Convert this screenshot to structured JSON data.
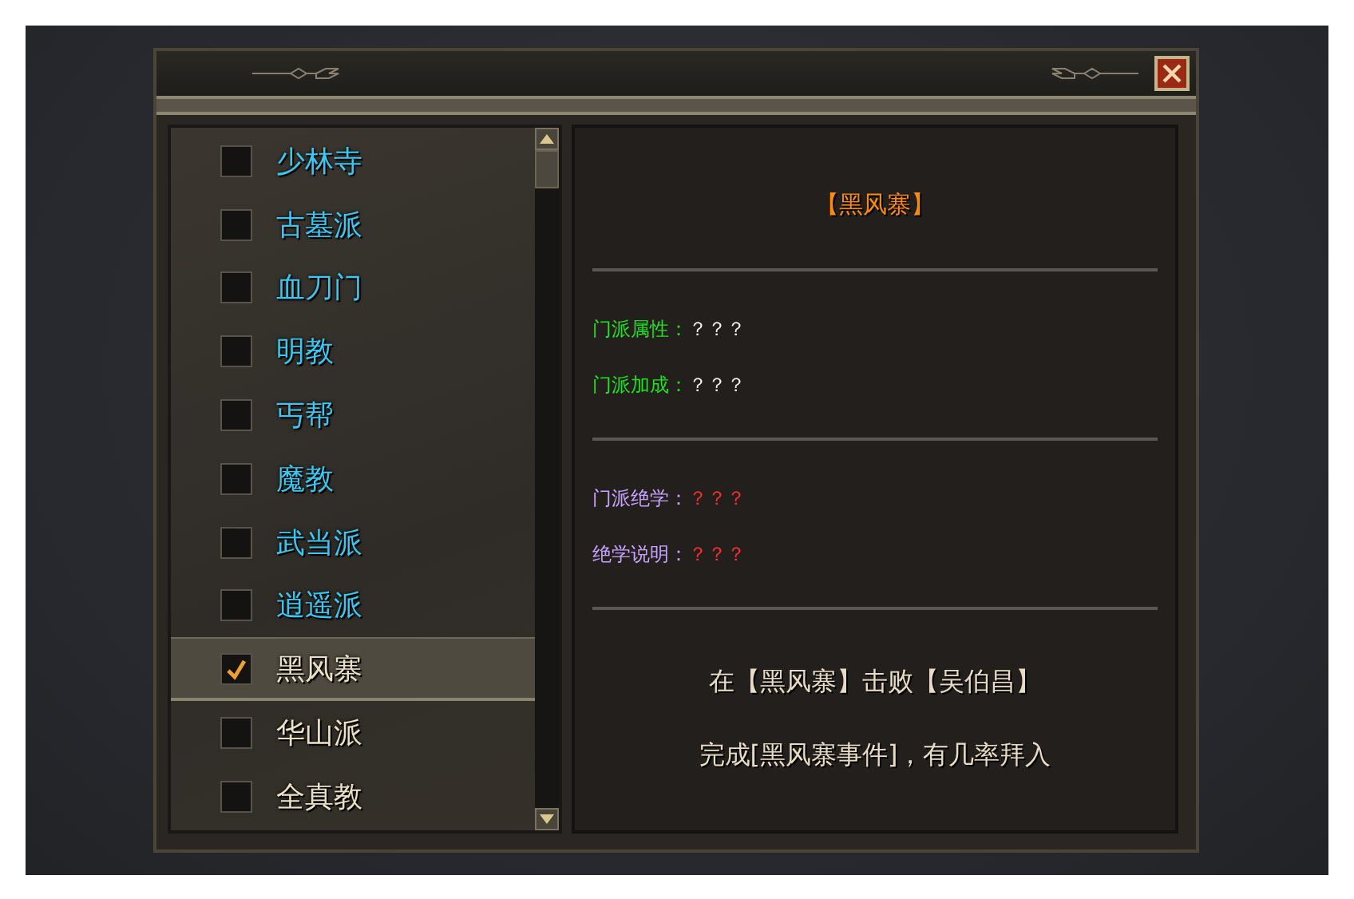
{
  "sect_list": {
    "items": [
      {
        "label": "少林寺",
        "checked": false,
        "selected": false,
        "color": "#3cc6f2"
      },
      {
        "label": "古墓派",
        "checked": false,
        "selected": false,
        "color": "#3cc6f2"
      },
      {
        "label": "血刀门",
        "checked": false,
        "selected": false,
        "color": "#3cc6f2"
      },
      {
        "label": "明教",
        "checked": false,
        "selected": false,
        "color": "#3cc6f2"
      },
      {
        "label": "丐帮",
        "checked": false,
        "selected": false,
        "color": "#3cc6f2"
      },
      {
        "label": "魔教",
        "checked": false,
        "selected": false,
        "color": "#3cc6f2"
      },
      {
        "label": "武当派",
        "checked": false,
        "selected": false,
        "color": "#3cc6f2"
      },
      {
        "label": "逍遥派",
        "checked": false,
        "selected": false,
        "color": "#3cc6f2"
      },
      {
        "label": "黑风寨",
        "checked": true,
        "selected": true,
        "color": "#ece0c4"
      },
      {
        "label": "华山派",
        "checked": false,
        "selected": false,
        "color": "#ece0c4"
      },
      {
        "label": "全真教",
        "checked": false,
        "selected": false,
        "color": "#ece0c4"
      }
    ]
  },
  "detail": {
    "title": "【黑风寨】",
    "sections": [
      {
        "kind": "attributes",
        "rows": [
          {
            "label": "门派属性：",
            "value": "？？？"
          },
          {
            "label": "门派加成：",
            "value": "？？？"
          }
        ]
      },
      {
        "kind": "skills",
        "rows": [
          {
            "label": "门派绝学：",
            "value": "？？？"
          },
          {
            "label": "绝学说明：",
            "value": "？？？"
          }
        ]
      }
    ],
    "conditions": [
      "在【黑风寨】击败【吴伯昌】",
      "完成[黑风寨事件]，有几率拜入"
    ]
  }
}
